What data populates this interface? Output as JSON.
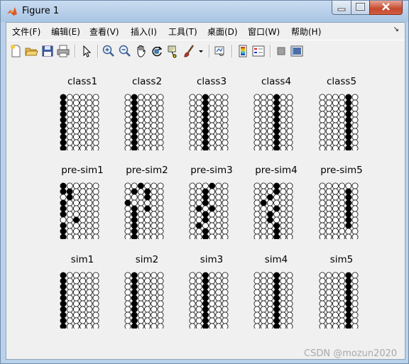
{
  "window": {
    "title": "Figure 1"
  },
  "menu": [
    "文件(F)",
    "编辑(E)",
    "查看(V)",
    "插入(I)",
    "工具(T)",
    "桌面(D)",
    "窗口(W)",
    "帮助(H)"
  ],
  "toolbar_icons": [
    "new-file-icon",
    "open-folder-icon",
    "save-icon",
    "print-icon",
    "select-arrow-icon",
    "zoom-in-icon",
    "zoom-out-icon",
    "pan-hand-icon",
    "rotate-3d-icon",
    "data-cursor-icon",
    "brush-icon",
    "brush-dropdown-icon",
    "link-plot-icon",
    "colorbar-icon",
    "legend-icon",
    "hide-plot-tools-icon",
    "show-plot-tools-icon"
  ],
  "panels": {
    "class": {
      "titles": [
        "class1",
        "class2",
        "class3",
        "class4",
        "class5"
      ],
      "patterns": [
        [
          "100000",
          "100000",
          "100000",
          "100000",
          "100000",
          "100000",
          "100000",
          "100000",
          "100000",
          "100000"
        ],
        [
          "010000",
          "010000",
          "010000",
          "010000",
          "010000",
          "010000",
          "010000",
          "010000",
          "010000",
          "010000"
        ],
        [
          "001000",
          "001000",
          "001000",
          "001000",
          "001000",
          "001000",
          "001000",
          "001000",
          "001000",
          "001000"
        ],
        [
          "000100",
          "000100",
          "000100",
          "000100",
          "000100",
          "000100",
          "000100",
          "000100",
          "000100",
          "000100"
        ],
        [
          "000010",
          "000010",
          "000010",
          "000010",
          "000010",
          "000010",
          "000010",
          "000010",
          "000010",
          "000010"
        ]
      ]
    },
    "presim": {
      "titles": [
        "pre-sim1",
        "pre-sim2",
        "pre-sim3",
        "pre-sim4",
        "pre-sim5"
      ],
      "patterns": [
        [
          "100000",
          "110000",
          "010000",
          "100000",
          "100000",
          "100000",
          "001000",
          "100000",
          "100000",
          "100000"
        ],
        [
          "001000",
          "010100",
          "000100",
          "100000",
          "010100",
          "010000",
          "010000",
          "010000",
          "010000",
          "010000"
        ],
        [
          "000100",
          "001000",
          "001000",
          "001000",
          "010100",
          "001000",
          "001000",
          "010000",
          "001000",
          "001000"
        ],
        [
          "000100",
          "000100",
          "001000",
          "010000",
          "000100",
          "001000",
          "001000",
          "000100",
          "000100",
          "000100"
        ],
        [
          "000000",
          "000010",
          "000010",
          "000010",
          "000010",
          "000010",
          "000010",
          "000010",
          "000000",
          "000000"
        ]
      ]
    },
    "sim": {
      "titles": [
        "sim1",
        "sim2",
        "sim3",
        "sim4",
        "sim5"
      ],
      "patterns": [
        [
          "100000",
          "100000",
          "100000",
          "100000",
          "100000",
          "100000",
          "100000",
          "100000",
          "100000",
          "100000"
        ],
        [
          "010000",
          "010000",
          "010000",
          "010000",
          "010000",
          "010000",
          "010000",
          "010000",
          "010000",
          "010000"
        ],
        [
          "001000",
          "001000",
          "001000",
          "001000",
          "001000",
          "001000",
          "001000",
          "001000",
          "001000",
          "001000"
        ],
        [
          "000100",
          "000100",
          "000100",
          "000100",
          "000100",
          "000100",
          "000100",
          "000100",
          "000100",
          "000100"
        ],
        [
          "000010",
          "000010",
          "000010",
          "000010",
          "000010",
          "000010",
          "000010",
          "000010",
          "000010",
          "000010"
        ]
      ]
    }
  },
  "watermark": "CSDN @mozun2020"
}
